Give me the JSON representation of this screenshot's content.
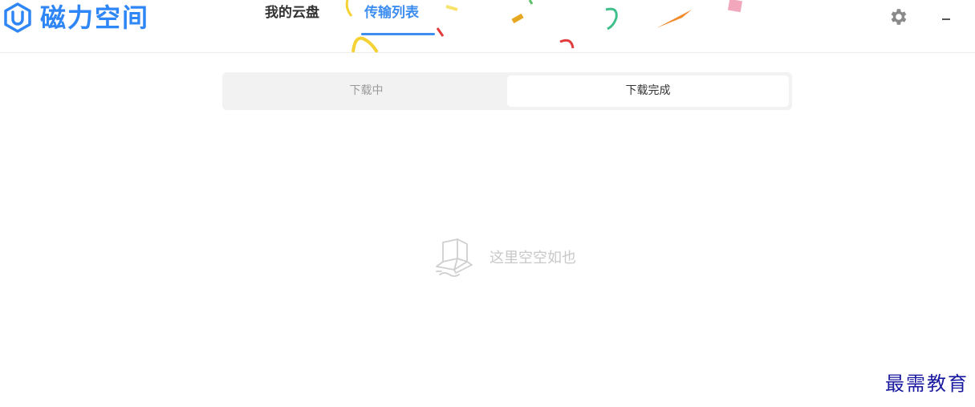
{
  "app": {
    "name": "磁力空间"
  },
  "nav": {
    "tabs": [
      {
        "label": "我的云盘",
        "active": false
      },
      {
        "label": "传输列表",
        "active": true
      }
    ]
  },
  "window_controls": {
    "settings_icon": "gear-icon",
    "minimize_label": "–"
  },
  "segment": {
    "tabs": [
      {
        "label": "下载中",
        "active": false
      },
      {
        "label": "下载完成",
        "active": true
      }
    ]
  },
  "empty_state": {
    "icon": "empty-box-icon",
    "text": "这里空空如也"
  },
  "watermark": {
    "text": "最需教育"
  },
  "colors": {
    "accent": "#3d8ef0",
    "logo": "#2f86f6",
    "segment_bg": "#f2f2f2",
    "watermark": "#1a1aa0"
  }
}
